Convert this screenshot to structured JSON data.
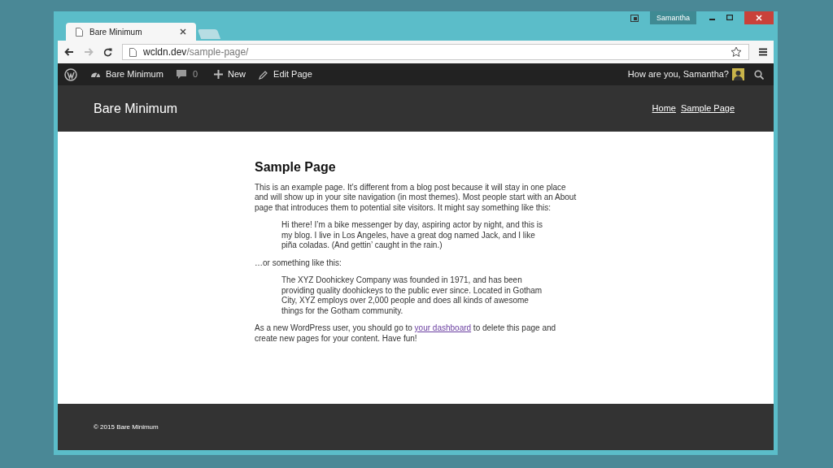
{
  "titlebar": {
    "user": "Samantha"
  },
  "tabs": [
    {
      "label": "Bare Minimum",
      "selected": true
    },
    {
      "selected": false
    }
  ],
  "address_bar": {
    "host": "wcldn.dev",
    "path": "/sample-page/"
  },
  "admin_bar": {
    "site": "Bare Minimum",
    "comments": "0",
    "new": "New",
    "edit": "Edit Page",
    "greeting": "How are you, Samantha?"
  },
  "site_header": {
    "title": "Bare Minimum",
    "nav": [
      {
        "label": "Home"
      },
      {
        "label": "Sample Page"
      }
    ]
  },
  "page": {
    "title": "Sample Page",
    "blocks": [
      {
        "kind": "paragraph",
        "text": "This is an example page. It’s different from a blog post because it will stay in one place and will show up in your site navigation (in most themes). Most people start with an About page that introduces them to potential site visitors. It might say something like this:"
      },
      {
        "kind": "quote",
        "text": "Hi there! I’m a bike messenger by day, aspiring actor by night, and this is my blog. I live in Los Angeles, have a great dog named Jack, and I like piña coladas. (And gettin’ caught in the rain.)"
      },
      {
        "kind": "paragraph",
        "text": "…or something like this:"
      },
      {
        "kind": "quote",
        "text": "The XYZ Doohickey Company was founded in 1971, and has been providing quality doohickeys to the public ever since. Located in Gotham City, XYZ employs over 2,000 people and does all kinds of awesome things for the Gotham community."
      }
    ],
    "closing": {
      "before": "As a new WordPress user, you should go to ",
      "link": "your dashboard",
      "after": " to delete this page and create new pages for your content. Have fun!"
    }
  },
  "footer": {
    "text": "© 2015 Bare Minimum"
  }
}
